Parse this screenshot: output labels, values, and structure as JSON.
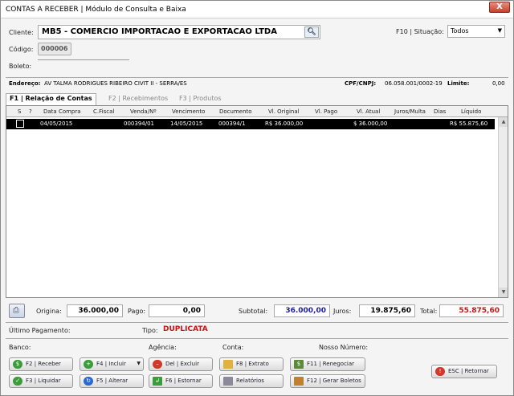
{
  "window": {
    "title": "CONTAS A RECEBER | Módulo de Consulta e Baixa",
    "close": "X"
  },
  "client": {
    "label": "Cliente:",
    "value": "MB5 - COMERCIO IMPORTACAO E EXPORTACAO LTDA"
  },
  "situacao": {
    "label": "F10 | Situação:",
    "value": "Todos"
  },
  "codigo": {
    "label": "Código:",
    "value": "000006"
  },
  "boleto": {
    "label": "Boleto:"
  },
  "address": {
    "label": "Endereço:",
    "value": "AV TALMA RODRIGUES RIBEIRO CIVIT II - SERRA/ES",
    "cpf_label": "CPF/CNPJ:",
    "cpf_value": "06.058.001/0002-19",
    "limite_label": "Limite:",
    "limite_value": "0,00"
  },
  "tabs": [
    "F1 | Relação de Contas",
    "F2 | Recebimentos",
    "F3 | Produtos"
  ],
  "grid": {
    "columns": [
      "S",
      "?",
      "Data Compra",
      "C.Fiscal",
      "Venda/Nº",
      "Vencimento",
      "Documento",
      "Vl. Original",
      "Vl. Pago",
      "Vl. Atual",
      "Juros/Multa",
      "Dias",
      "Líquido"
    ],
    "rows": [
      {
        "data_compra": "04/05/2015",
        "c_fiscal": "",
        "venda": "000394/01",
        "vencimento": "14/05/2015",
        "documento": "000394/1",
        "vl_original": "R$ 36.000,00",
        "vl_pago": "",
        "vl_atual": "$ 36.000,00",
        "juros": "",
        "dias": "",
        "liquido": "R$ 55.875,60"
      }
    ]
  },
  "totals": {
    "origina_label": "Origina:",
    "origina_value": "36.000,00",
    "pago_label": "Pago:",
    "pago_value": "0,00",
    "subtotal_label": "Subtotal:",
    "subtotal_value": "36.000,00",
    "juros_label": "Juros:",
    "juros_value": "19.875,60",
    "total_label": "Total:",
    "total_value": "55.875,60"
  },
  "info": {
    "ultimo_pagamento": "Último Pagamento:",
    "tipo_label": "Tipo:",
    "tipo_value": "DUPLICATA",
    "banco": "Banco:",
    "agencia": "Agência:",
    "conta": "Conta:",
    "nosso_numero": "Nosso Número:"
  },
  "buttons": {
    "receber": "F2 | Receber",
    "incluir": "F4 | Incluir",
    "excluir": "Del | Excluir",
    "extrato": "F8 | Extrato",
    "renegociar": "F11 | Renegociar",
    "liquidar": "F3 | Liquidar",
    "alterar": "F5 | Alterar",
    "estornar": "F6 | Estornar",
    "relatorios": "Relatórios",
    "gerar_boletos": "F12 | Gerar Boletos",
    "retornar": "ESC | Retornar"
  },
  "colors": {
    "subtotal": "#1a1ab0",
    "total": "#d01010",
    "tipo": "#d01010",
    "selected_row": "#000000"
  },
  "icons": [
    "search-icon",
    "dropdown-arrow-icon",
    "print-icon",
    "close-icon"
  ]
}
